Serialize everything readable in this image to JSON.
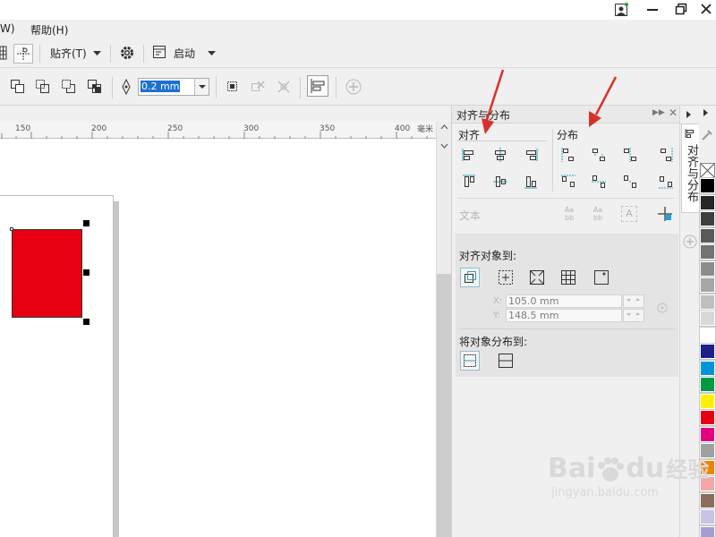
{
  "menubar": {
    "items": [
      "W)",
      "帮助(H)"
    ]
  },
  "toolbar": {
    "snap_label": "贴齐(T)",
    "launch_label": "启动"
  },
  "propbar": {
    "outline_width": "0.2 mm"
  },
  "ruler": {
    "ticks": [
      "150",
      "200",
      "250",
      "300",
      "350",
      "400"
    ],
    "unit": "毫米"
  },
  "docker": {
    "title": "对齐与分布",
    "align_heading": "对齐",
    "distribute_heading": "分布",
    "text_label": "文本",
    "align_to_heading": "对齐对象到:",
    "x_label": "X:",
    "x_value": "105.0 mm",
    "y_label": "Y:",
    "y_value": "148.5 mm",
    "distribute_to_heading": "将对象分布到:",
    "text_icon_labels": [
      "Aa",
      "bb",
      "Aa",
      "bb",
      "A"
    ]
  },
  "tabstrip": {
    "tab_label": "对齐与分布"
  },
  "palette": {
    "colors": [
      "#000000",
      "#262626",
      "#3f3f3f",
      "#595959",
      "#737373",
      "#8c8c8c",
      "#a6a6a6",
      "#bfbfbf",
      "#d9d9d9",
      "#ffffff",
      "#1d2088",
      "#0095d9",
      "#009944",
      "#fff100",
      "#e60012",
      "#e4007f",
      "#a0a0a0",
      "#f08300",
      "#f5a6a6",
      "#8a6d5f",
      "#c9c3e6",
      "#a79cd2",
      "#7d6fbd"
    ]
  },
  "canvas": {
    "shape_color": "#e60012"
  },
  "accent": "#d9302b",
  "watermark": {
    "brand": "Bai",
    "brand_mid": "du",
    "brand_cn": "经验",
    "url": "jingyan.baidu.com"
  }
}
